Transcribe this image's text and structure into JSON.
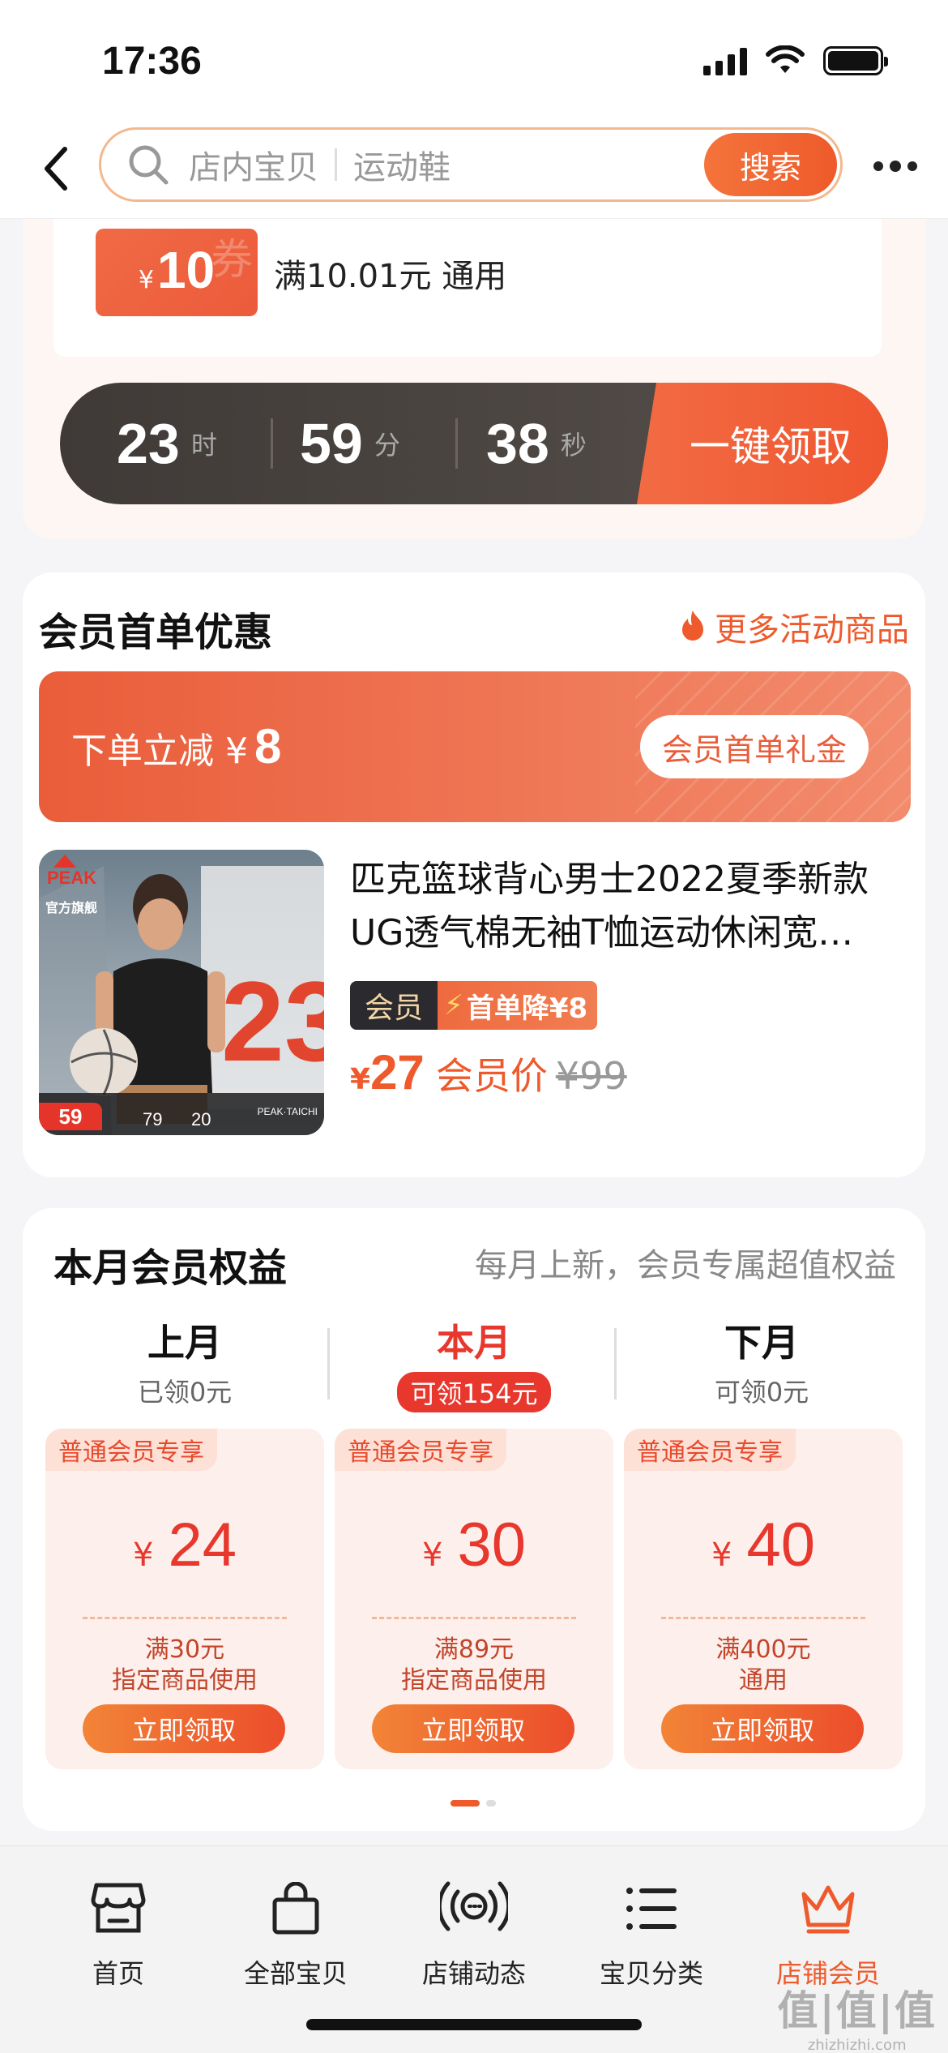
{
  "status_bar": {
    "time": "17:36"
  },
  "search": {
    "placeholder_left": "店内宝贝",
    "placeholder_right": "运动鞋",
    "button_label": "搜索"
  },
  "coupon": {
    "currency": "¥",
    "amount": "10",
    "watermark": "券",
    "description": "满10.01元 通用"
  },
  "countdown": {
    "hours": "23",
    "hours_unit": "时",
    "minutes": "59",
    "minutes_unit": "分",
    "seconds": "38",
    "seconds_unit": "秒",
    "claim_all_label": "一键领取"
  },
  "first_order": {
    "title": "会员首单优惠",
    "more_link": "更多活动商品",
    "banner_text": "下单立减 ¥",
    "banner_amount": "8",
    "banner_button": "会员首单礼金",
    "product": {
      "name": "匹克篮球背心男士2022夏季新款UG透气棉无袖T恤运动休闲宽…",
      "tag_member": "会员",
      "tag_first": "首单降¥8",
      "price_currency": "¥",
      "price": "27",
      "price_label": "会员价",
      "original_price": "¥99",
      "image": {
        "brand": "PEAK",
        "store": "官方旗舰",
        "price_badge": "59",
        "stat1": "79",
        "stat2": "20",
        "jersey_number": "23",
        "footer_brand": "PEAK·TAICHI"
      }
    }
  },
  "benefits": {
    "title": "本月会员权益",
    "subtitle": "每月上新，会员专属超值权益",
    "months": [
      {
        "name": "上月",
        "sub": "已领0元"
      },
      {
        "name": "本月",
        "sub": "可领154元"
      },
      {
        "name": "下月",
        "sub": "可领0元"
      }
    ],
    "coupons": [
      {
        "tag": "普通会员专享",
        "currency": "¥",
        "amount": "24",
        "cond1": "满30元",
        "cond2": "指定商品使用",
        "button": "立即领取"
      },
      {
        "tag": "普通会员专享",
        "currency": "¥",
        "amount": "30",
        "cond1": "满89元",
        "cond2": "指定商品使用",
        "button": "立即领取"
      },
      {
        "tag": "普通会员专享",
        "currency": "¥",
        "amount": "40",
        "cond1": "满400元",
        "cond2": "通用",
        "button": "立即领取"
      }
    ]
  },
  "tabbar": {
    "items": [
      {
        "label": "首页",
        "icon": "storefront-icon"
      },
      {
        "label": "全部宝贝",
        "icon": "shopping-bag-icon"
      },
      {
        "label": "店铺动态",
        "icon": "broadcast-icon"
      },
      {
        "label": "宝贝分类",
        "icon": "list-icon"
      },
      {
        "label": "店铺会员",
        "icon": "crown-icon"
      }
    ],
    "active_index": 4
  },
  "watermark": {
    "main": "值|值|值",
    "sub": "zhizhizhi.com"
  },
  "colors": {
    "accent": "#ee5a2b",
    "red": "#e8372d",
    "dark": "#3f3a37"
  }
}
